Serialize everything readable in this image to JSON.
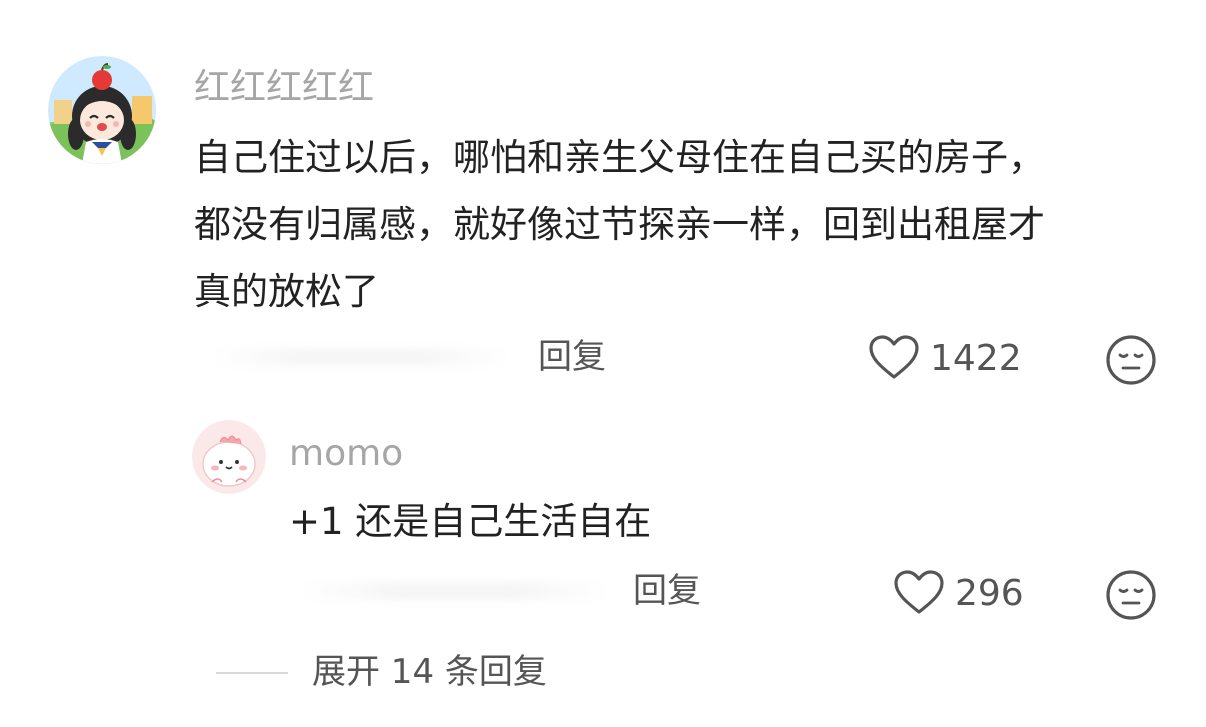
{
  "comments": [
    {
      "username": "红红红红红",
      "lines": [
        "自己住过以后，哪怕和亲生父母住在自己买的房子，",
        "都没有归属感，就好像过节探亲一样，回到出租屋才",
        "真的放松了"
      ],
      "reply_label": "回复",
      "likes": "1422",
      "avatar_icon": "anime-girl-apple-avatar",
      "like_icon": "heart-outline-icon",
      "dislike_icon": "meh-face-icon"
    }
  ],
  "reply": {
    "username": "momo",
    "text": "+1 还是自己生活自在",
    "reply_label": "回复",
    "likes": "296",
    "avatar_icon": "pink-blob-avatar",
    "like_icon": "heart-outline-icon",
    "dislike_icon": "meh-face-icon"
  },
  "expand": {
    "label": "展开 14 条回复"
  },
  "colors": {
    "username": "#a6a6a6",
    "text": "#222222",
    "meta": "#555555",
    "divider": "#d9d9d9"
  }
}
